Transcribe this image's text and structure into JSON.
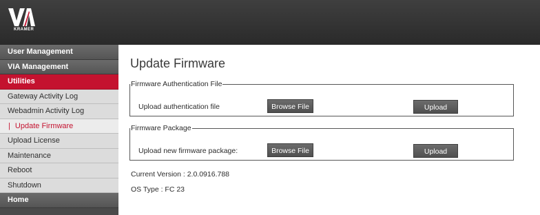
{
  "header": {
    "logo_text": "VIA",
    "logo_subtext": "KRAMER"
  },
  "sidebar": {
    "items": [
      {
        "label": "User Management"
      },
      {
        "label": "VIA Management"
      },
      {
        "label": "Utilities"
      },
      {
        "label": "Gateway Activity Log"
      },
      {
        "label": "Webadmin Activity Log"
      },
      {
        "label": "Update Firmware",
        "marker": "|"
      },
      {
        "label": "Upload License"
      },
      {
        "label": "Maintenance"
      },
      {
        "label": "Reboot"
      },
      {
        "label": "Shutdown"
      },
      {
        "label": "Home"
      }
    ]
  },
  "main": {
    "title": "Update Firmware",
    "auth_section": {
      "legend": "Firmware Authentication File",
      "label": "Upload authentication file",
      "browse_label": "Browse File",
      "upload_label": "Upload"
    },
    "package_section": {
      "legend": "Firmware Package",
      "label": "Upload new firmware package:",
      "browse_label": "Browse File",
      "upload_label": "Upload"
    },
    "current_version": "Current Version :  2.0.0916.788",
    "os_type": "OS Type  : FC 23"
  },
  "colors": {
    "accent": "#c4122f",
    "topbar": "#333333",
    "sidebar_section": "#5e5e5e",
    "sidebar_item": "#dcdcdc",
    "button": "#5e5e5e"
  }
}
